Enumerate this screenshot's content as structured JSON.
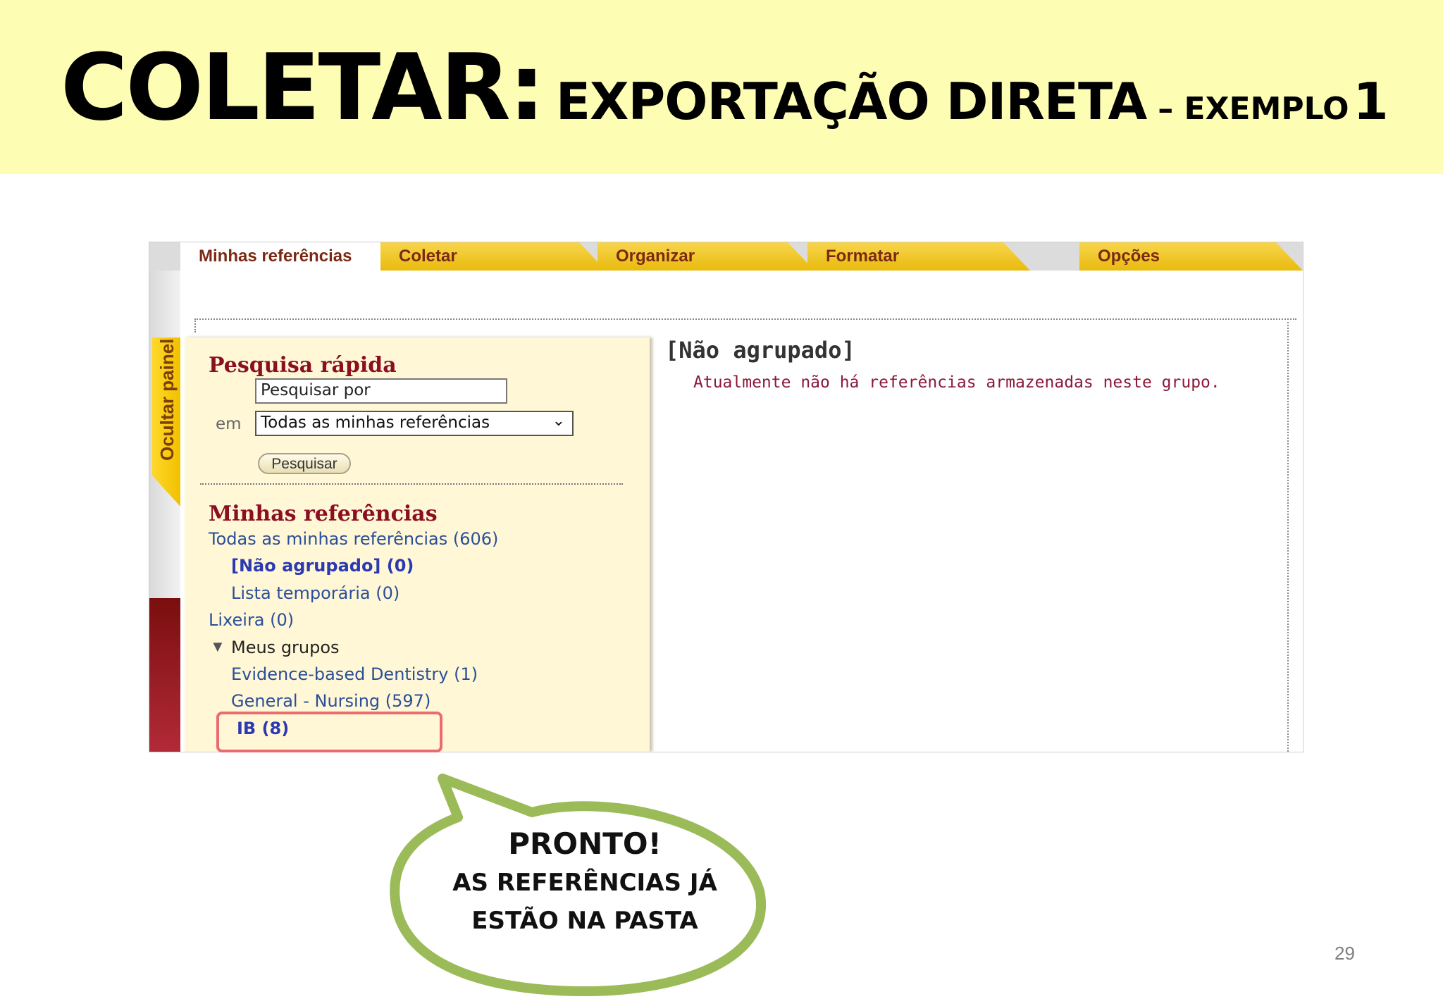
{
  "slide": {
    "title_main": "COLETAR:",
    "title_sub": "EXPORTAÇÃO DIRETA",
    "title_dash": "– EXEMPLO",
    "title_num": "1",
    "page_number": "29",
    "band_color": "#fefdb4"
  },
  "tabs": [
    {
      "label": "Minhas referências",
      "active": true
    },
    {
      "label": "Coletar",
      "active": false
    },
    {
      "label": "Organizar",
      "active": false
    },
    {
      "label": "Formatar",
      "active": false
    },
    {
      "label": "Opções",
      "active": false
    }
  ],
  "sidebar": {
    "hide_panel_label": "Ocultar painel"
  },
  "quick_search": {
    "heading": "Pesquisa rápida",
    "input_value": "Pesquisar por",
    "in_label": "em",
    "scope_selected": "Todas as minhas referências",
    "search_button": "Pesquisar"
  },
  "my_references": {
    "heading": "Minhas referências",
    "all": "Todas as minhas referências (606)",
    "unfiled": "[Não agrupado] (0)",
    "quick_list": "Lista temporária (0)",
    "trash": "Lixeira (0)",
    "my_groups": "Meus grupos",
    "groups": [
      "Evidence-based Dentistry  (1)",
      "General - Nursing  (597)",
      "IB (8)"
    ]
  },
  "main": {
    "title": "[Não agrupado]",
    "message": "Atualmente não há referências armazenadas neste grupo."
  },
  "callout": {
    "line1": "PRONTO!",
    "line2": "AS REFERÊNCIAS JÁ",
    "line3": "ESTÃO NA PASTA",
    "border_color": "#9bbb59"
  },
  "colors": {
    "heading": "#8b0f22",
    "link": "#2a4f9a",
    "highlight": "#ec6b6e",
    "tab_yellow": "#f1c40f"
  }
}
